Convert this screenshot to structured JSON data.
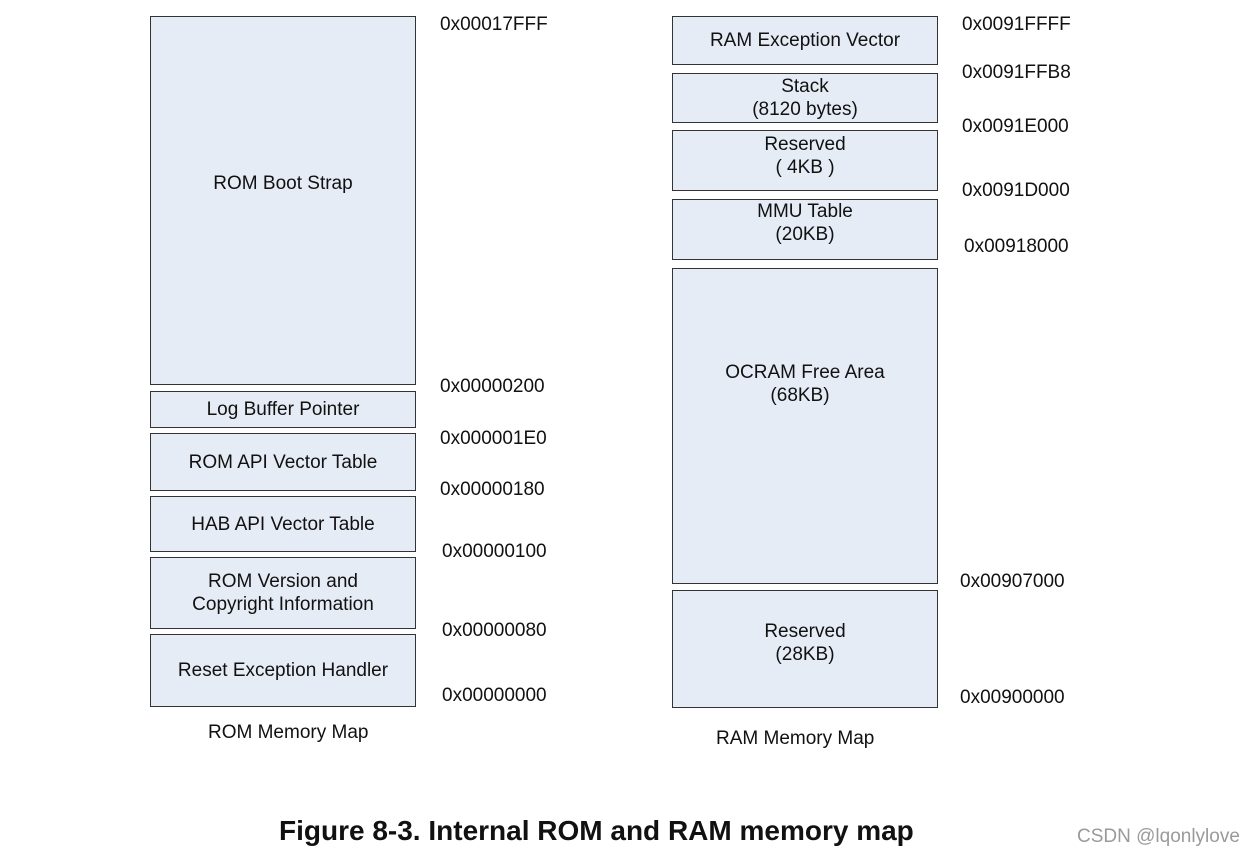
{
  "rom": {
    "title": "ROM Memory Map",
    "regions": [
      {
        "lines": [
          "ROM Boot Strap"
        ]
      },
      {
        "lines": [
          "Log Buffer Pointer"
        ]
      },
      {
        "lines": [
          "ROM API Vector Table"
        ]
      },
      {
        "lines": [
          "HAB API Vector Table"
        ]
      },
      {
        "lines": [
          "ROM Version and",
          "Copyright Information"
        ]
      },
      {
        "lines": [
          "Reset Exception Handler"
        ]
      }
    ],
    "addresses": [
      "0x00017FFF",
      "0x00000200",
      "0x000001E0",
      "0x00000180",
      "0x00000100",
      "0x00000080",
      "0x00000000"
    ]
  },
  "ram": {
    "title": "RAM Memory Map",
    "regions": [
      {
        "lines": [
          "RAM Exception Vector"
        ]
      },
      {
        "lines": [
          "Stack",
          "(8120 bytes)"
        ]
      },
      {
        "lines": [
          "Reserved",
          "( 4KB )"
        ]
      },
      {
        "lines": [
          "MMU Table",
          "(20KB)"
        ]
      },
      {
        "lines": [
          "OCRAM Free Area",
          "(68KB)"
        ]
      },
      {
        "lines": [
          "Reserved",
          "(28KB)"
        ]
      }
    ],
    "addresses": [
      "0x0091FFFF",
      "0x0091FFB8",
      "0x0091E000",
      "0x0091D000",
      "0x00918000",
      "0x00907000",
      "0x00900000"
    ]
  },
  "caption": "Figure 8-3. Internal ROM and RAM memory map",
  "watermark": "CSDN @lqonlylove",
  "colors": {
    "region_fill": "#e6ecf6",
    "region_border": "#333333"
  }
}
